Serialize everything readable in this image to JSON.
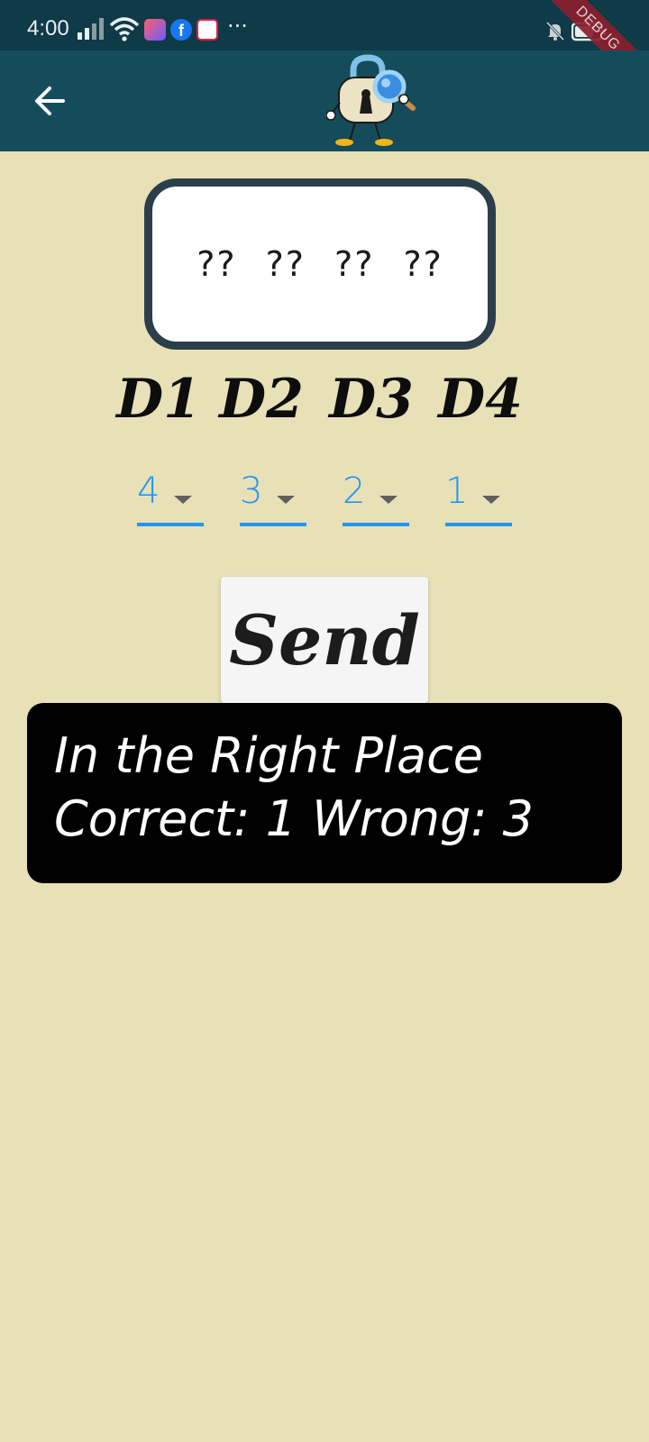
{
  "status_bar": {
    "time": "4:00",
    "more": "···",
    "debug_banner": "DEBUG",
    "icons": [
      "signal-icon",
      "wifi-icon",
      "app-badge-icon",
      "facebook-icon",
      "app-badge-icon",
      "more-icon",
      "mute-icon",
      "battery-icon"
    ]
  },
  "app_bar": {
    "back_icon": "arrow-left-icon",
    "logo": "lock-detective-mascot"
  },
  "code": {
    "display": "?? ?? ?? ??"
  },
  "digits": {
    "labels": [
      "D1",
      "D2",
      "D3",
      "D4"
    ],
    "selected": [
      "4",
      "3",
      "2",
      "1"
    ]
  },
  "actions": {
    "send_label": "Send"
  },
  "result": {
    "line1": "In the Right Place",
    "line2": "Correct: 1 Wrong: 3"
  },
  "colors": {
    "background": "#e8e1b8",
    "app_bar": "#154c5c",
    "status_bar": "#0f3a48",
    "accent": "#2196f3",
    "result_panel": "#000000"
  }
}
